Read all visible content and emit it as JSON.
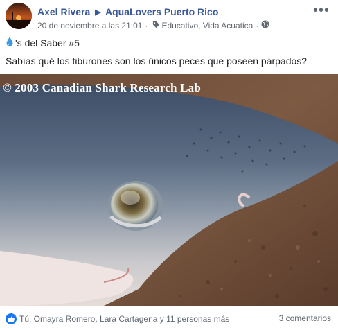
{
  "post": {
    "author": "Axel Rivera",
    "group": "AquaLovers Puerto Rico",
    "timestamp": "20 de noviembre a las 21:01",
    "dot": "·",
    "tags": "Educativo, Vida Acuatica",
    "title": "'s del Saber #5",
    "body": "Sabías qué los tiburones son los únicos peces que poseen párpados?",
    "more": "•••"
  },
  "photo": {
    "watermark": "© 2003 Canadian Shark Research Lab"
  },
  "footer": {
    "reactions": "Tú, Omayra Romero, Lara Cartagena y 11 personas más",
    "comments": "3 comentarios"
  },
  "icons": {
    "drop": "water-drop-icon",
    "tag": "tag-icon",
    "audience": "globe-icon",
    "like": "like-icon",
    "more": "more-options-icon"
  },
  "colors": {
    "link": "#385898",
    "meta": "#616770",
    "like": "#1877f2"
  }
}
